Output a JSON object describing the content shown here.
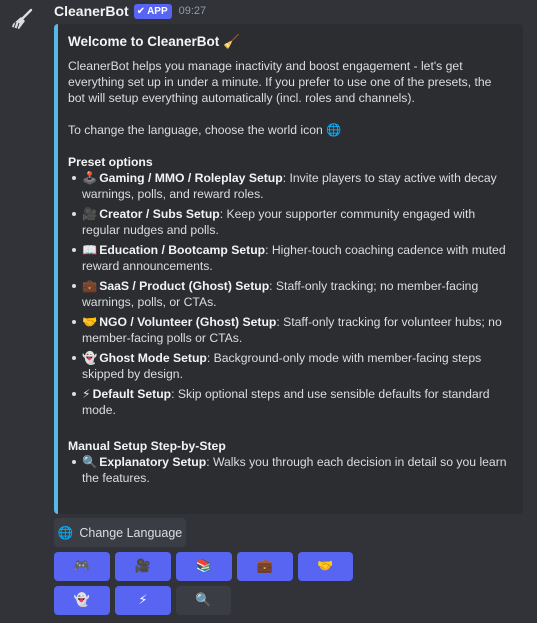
{
  "message": {
    "bot_name": "CleanerBot",
    "badge": "APP",
    "badge_check": "✔",
    "timestamp": "09:27",
    "avatar_icon": "broom-icon"
  },
  "embed": {
    "title": "Welcome to CleanerBot 🧹",
    "intro": "CleanerBot helps you manage inactivity and boost engagement - let's get everything set up in under a minute. If you prefer to use one of the presets, the bot will setup everything automatically (incl. roles and channels).",
    "language_hint": "To change the language, choose the world icon 🌐",
    "preset_heading": "Preset options",
    "presets": [
      {
        "emoji": "🕹️",
        "name": "Gaming / MMO / Roleplay Setup",
        "desc": ": Invite players to stay active with decay warnings, polls, and reward roles."
      },
      {
        "emoji": "🎥",
        "name": "Creator / Subs Setup",
        "desc": ": Keep your supporter community engaged with regular nudges and polls."
      },
      {
        "emoji": "📖",
        "name": "Education / Bootcamp Setup",
        "desc": ": Higher-touch coaching cadence with muted reward announcements."
      },
      {
        "emoji": "💼",
        "name": "SaaS / Product (Ghost) Setup",
        "desc": ": Staff-only tracking; no member-facing warnings, polls, or CTAs."
      },
      {
        "emoji": "🤝",
        "name": "NGO / Volunteer (Ghost) Setup",
        "desc": ": Staff-only tracking for volunteer hubs; no member-facing polls or CTAs."
      },
      {
        "emoji": "👻",
        "name": "Ghost Mode Setup",
        "desc": ": Background-only mode with member-facing steps skipped by design."
      },
      {
        "emoji": "⚡",
        "name": "Default Setup",
        "desc": ": Skip optional steps and use sensible defaults for standard mode."
      }
    ],
    "manual_heading": "Manual Setup Step-by-Step",
    "manual": [
      {
        "emoji": "🔍",
        "name": "Explanatory Setup",
        "desc": ": Walks you through each decision in detail so you learn the features."
      }
    ]
  },
  "buttons": {
    "change_language": {
      "icon": "🌐",
      "label": "Change Language"
    },
    "presets": [
      {
        "icon": "🎮",
        "icon_name": "game-controller-icon"
      },
      {
        "icon": "🎥",
        "icon_name": "movie-camera-icon"
      },
      {
        "icon": "📚",
        "icon_name": "books-icon"
      },
      {
        "icon": "💼",
        "icon_name": "briefcase-icon"
      },
      {
        "icon": "🤝",
        "icon_name": "handshake-icon"
      },
      {
        "icon": "👻",
        "icon_name": "ghost-icon"
      },
      {
        "icon": "⚡",
        "icon_name": "lightning-icon"
      },
      {
        "icon": "🔍",
        "icon_name": "magnifier-icon"
      }
    ]
  },
  "colors": {
    "background": "#313338",
    "embed_bg": "#2b2d31",
    "embed_accent": "#58b9e6",
    "blurple": "#5865f2",
    "gray_button": "#3b3d44"
  }
}
